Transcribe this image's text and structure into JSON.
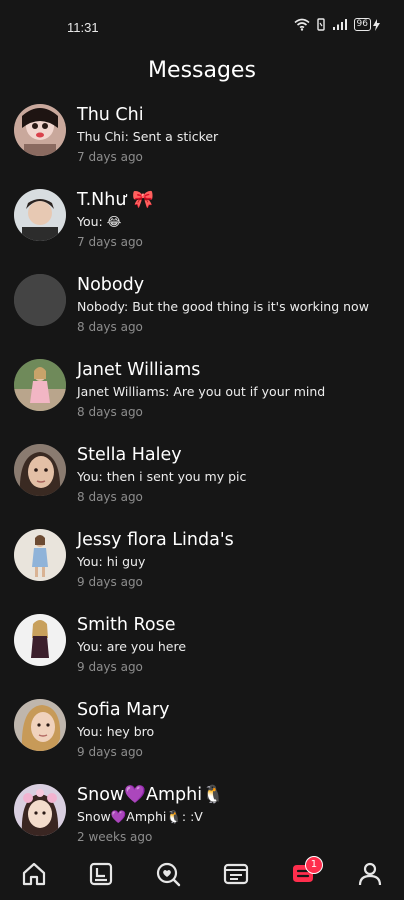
{
  "status_bar": {
    "time": "11:31",
    "battery": "96"
  },
  "header": {
    "title": "Messages"
  },
  "conversations": [
    {
      "name": "Thu Chi",
      "preview": "Thu Chi: Sent a sticker",
      "time": "7 days ago"
    },
    {
      "name": "T.Như 🎀",
      "preview": "You: 😂",
      "time": "7 days ago"
    },
    {
      "name": "Nobody",
      "preview": "Nobody: But the good thing is it's working now",
      "time": "8 days ago"
    },
    {
      "name": "Janet Williams",
      "preview": "Janet Williams: Are you out if your mind",
      "time": "8 days ago"
    },
    {
      "name": "Stella Haley",
      "preview": "You: then i sent you my pic",
      "time": "8 days ago"
    },
    {
      "name": "Jessy flora Linda's",
      "preview": "You: hi guy",
      "time": "9 days ago"
    },
    {
      "name": "Smith Rose",
      "preview": "You: are you here",
      "time": "9 days ago"
    },
    {
      "name": "Sofia Mary",
      "preview": "You: hey bro",
      "time": "9 days ago"
    },
    {
      "name": "Snow💜Amphi🐧",
      "preview": "Snow💜Amphi🐧: :V",
      "time": "2 weeks ago"
    }
  ],
  "bottom_nav": {
    "items": [
      {
        "icon": "home-icon"
      },
      {
        "icon": "feed-icon"
      },
      {
        "icon": "discover-icon"
      },
      {
        "icon": "moments-icon"
      },
      {
        "icon": "messages-icon",
        "badge": "1"
      },
      {
        "icon": "profile-icon"
      }
    ]
  },
  "colors": {
    "background": "#161616",
    "text": "#ffffff",
    "secondary_text": "#8d8d8d",
    "badge": "#ff2e4d"
  }
}
